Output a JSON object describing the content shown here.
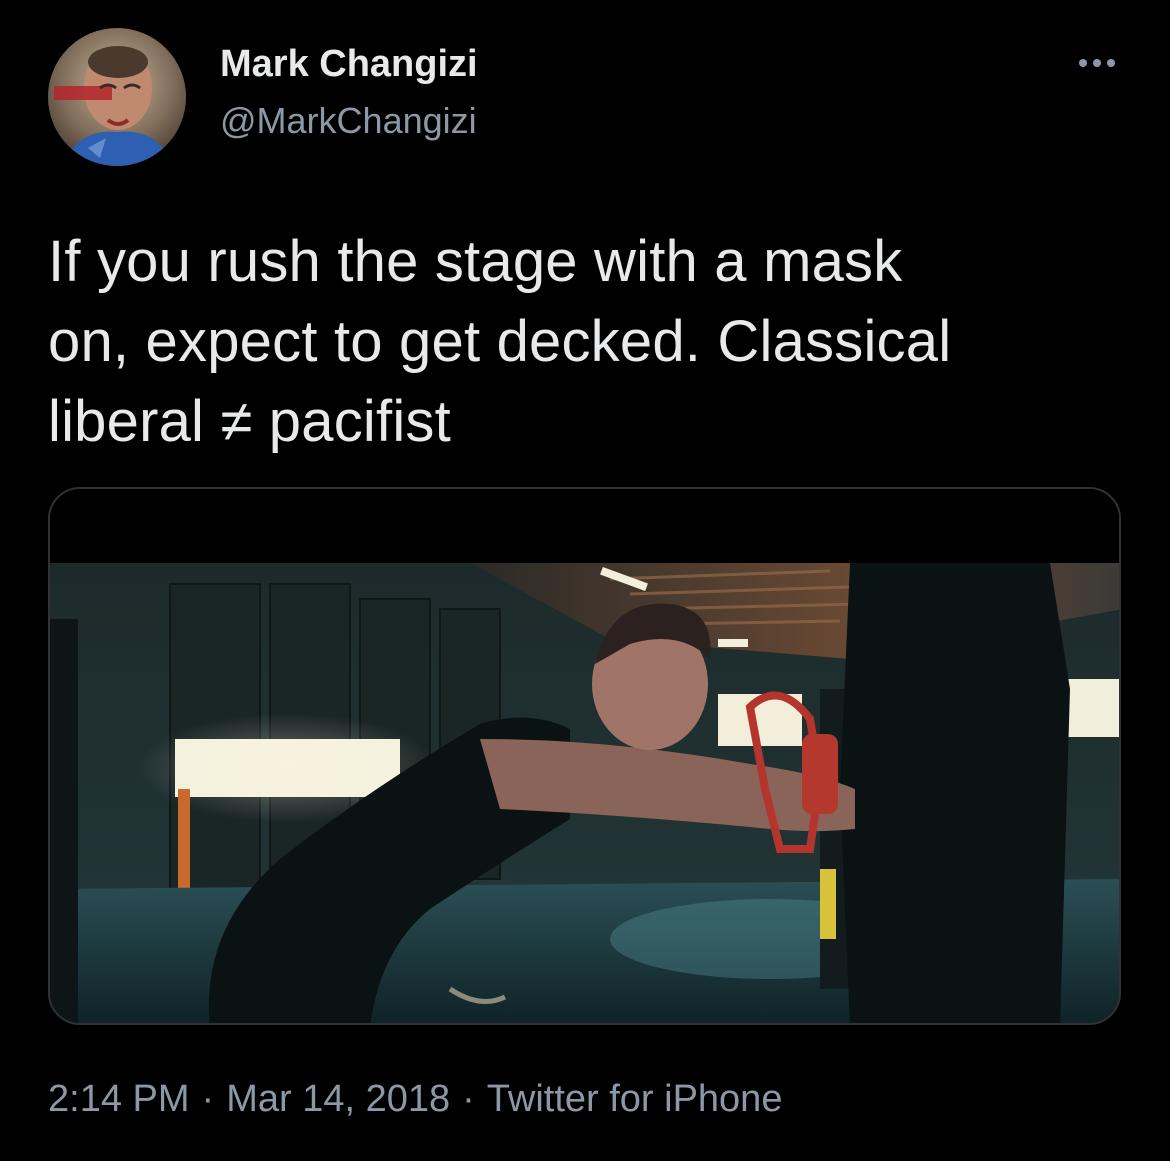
{
  "author": {
    "display_name": "Mark Changizi",
    "handle": "@MarkChangizi",
    "avatar": "painted-portrait-avatar"
  },
  "tweet": {
    "text_lines": [
      "If you rush the stage with a mask",
      "on, expect to get decked. Classical",
      "liberal ≠ pacifist"
    ],
    "media": "video-still-boxer-pushing-heavy-bag"
  },
  "meta": {
    "time": "2:14 PM",
    "separator": "·",
    "date": "Mar 14, 2018",
    "source": "Twitter for iPhone"
  },
  "icons": {
    "more": "more-dots-icon"
  },
  "colors": {
    "background": "#000000",
    "primary_text": "#e7e9ea",
    "secondary_text": "#8b98a5",
    "border": "#2f3336"
  }
}
